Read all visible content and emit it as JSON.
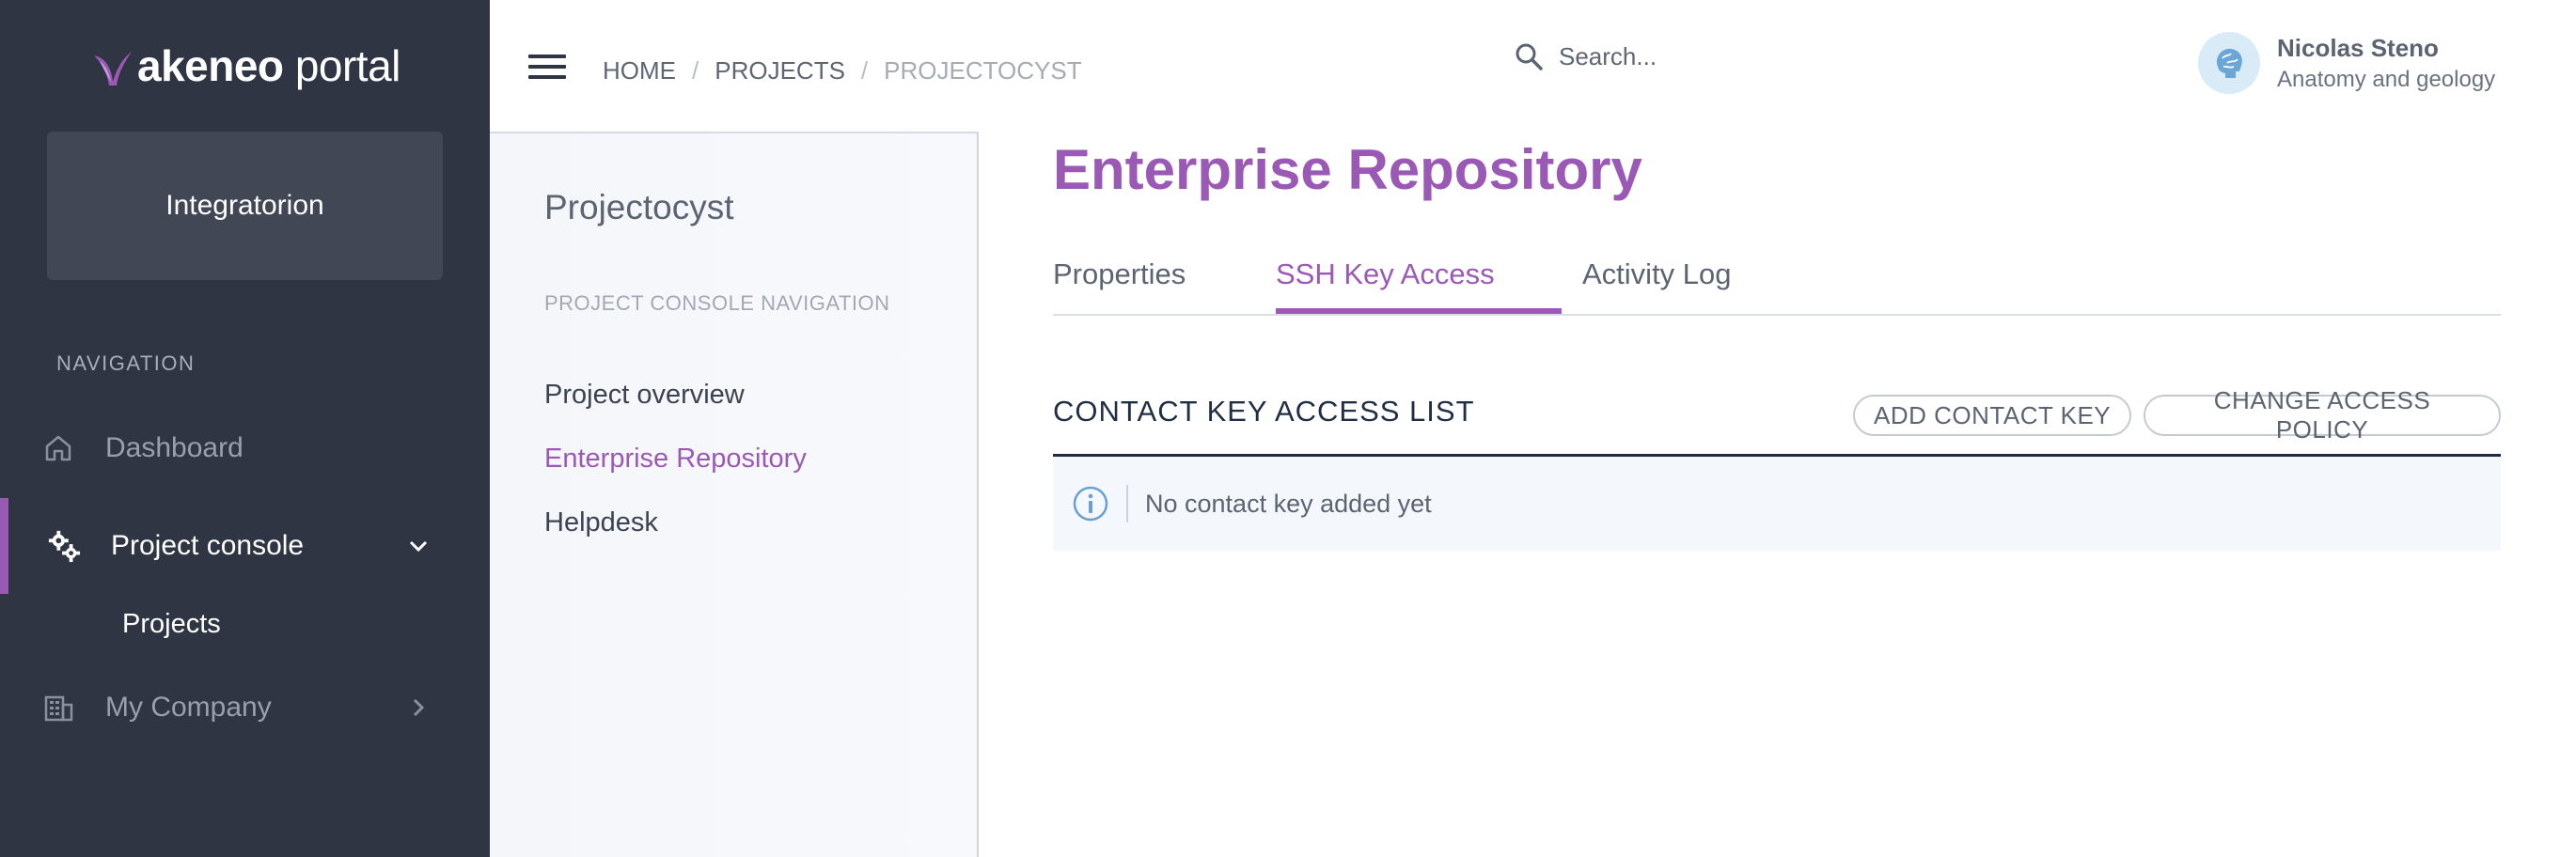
{
  "sidebar": {
    "logo_brand": "akeneo",
    "logo_suffix": "portal",
    "workspace": "Integratorion",
    "nav_heading": "NAVIGATION",
    "items": [
      {
        "label": "Dashboard",
        "icon": "home-icon"
      },
      {
        "label": "Project console",
        "icon": "gears-icon"
      },
      {
        "label": "My Company",
        "icon": "building-icon"
      }
    ],
    "sub_item": "Projects"
  },
  "header": {
    "breadcrumb": [
      "HOME",
      "PROJECTS",
      "PROJECTOCYST"
    ],
    "search_placeholder": "Search...",
    "user_name": "Nicolas Steno",
    "user_role": "Anatomy and geology"
  },
  "project_nav": {
    "title": "Projectocyst",
    "heading": "PROJECT CONSOLE NAVIGATION",
    "links": [
      "Project overview",
      "Enterprise Repository",
      "Helpdesk"
    ]
  },
  "main": {
    "title": "Enterprise Repository",
    "tabs": [
      "Properties",
      "SSH Key Access",
      "Activity Log"
    ],
    "section_title": "CONTACT KEY ACCESS LIST",
    "add_button": "ADD CONTACT KEY",
    "policy_button": "CHANGE ACCESS POLICY",
    "empty_message": "No contact key added yet"
  },
  "colors": {
    "accent": "#9b59b6",
    "sidebar_bg": "#2f3542",
    "navy": "#1f2e44"
  }
}
